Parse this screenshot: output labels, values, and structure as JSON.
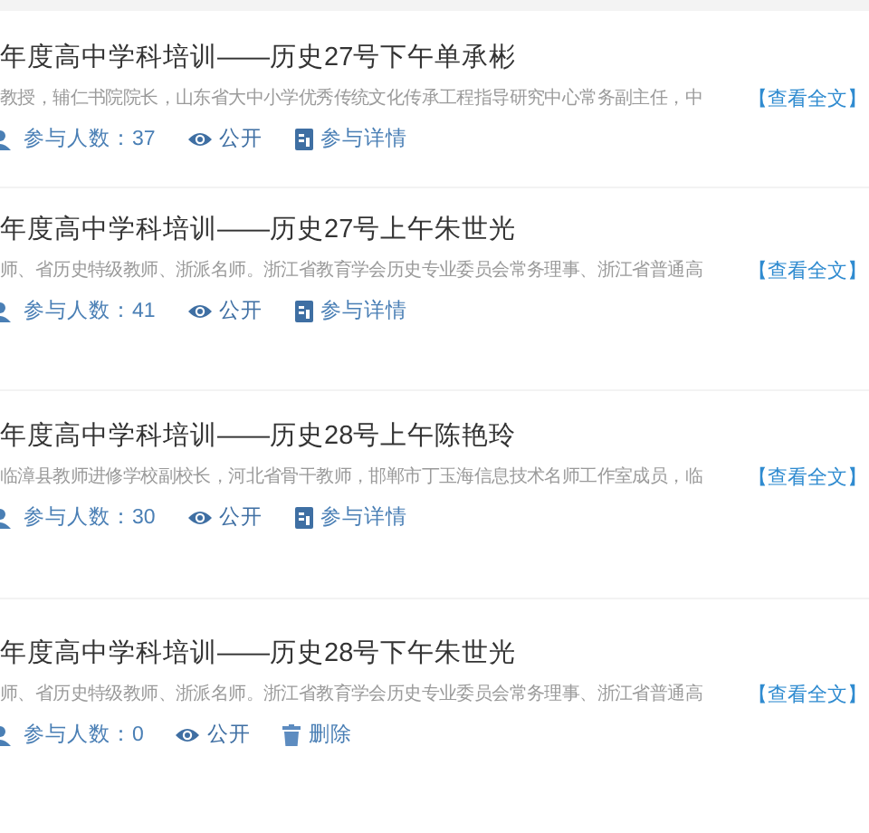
{
  "items": [
    {
      "title": "年度高中学科培训——历史27号下午单承彬",
      "description": "教授，辅仁书院院长，山东省大中小学优秀传统文化传承工程指导研究中心常务副主任，中",
      "more_link": "【查看全文】",
      "participants": "参与人数：37",
      "visibility": "公开",
      "action": {
        "kind": "details",
        "label": "参与详情"
      }
    },
    {
      "title": "年度高中学科培训——历史27号上午朱世光",
      "description": "师、省历史特级教师、浙派名师。浙江省教育学会历史专业委员会常务理事、浙江省普通高",
      "more_link": "【查看全文】",
      "participants": "参与人数：41",
      "visibility": "公开",
      "action": {
        "kind": "details",
        "label": "参与详情"
      }
    },
    {
      "title": "年度高中学科培训——历史28号上午陈艳玲",
      "description": "临漳县教师进修学校副校长，河北省骨干教师，邯郸市丁玉海信息技术名师工作室成员，临",
      "more_link": "【查看全文】",
      "participants": "参与人数：30",
      "visibility": "公开",
      "action": {
        "kind": "details",
        "label": "参与详情"
      }
    },
    {
      "title": "年度高中学科培训——历史28号下午朱世光",
      "description": "师、省历史特级教师、浙派名师。浙江省教育学会历史专业委员会常务理事、浙江省普通高",
      "more_link": "【查看全文】",
      "participants": "参与人数：0",
      "visibility": "公开",
      "action": {
        "kind": "delete",
        "label": "删除"
      }
    }
  ]
}
